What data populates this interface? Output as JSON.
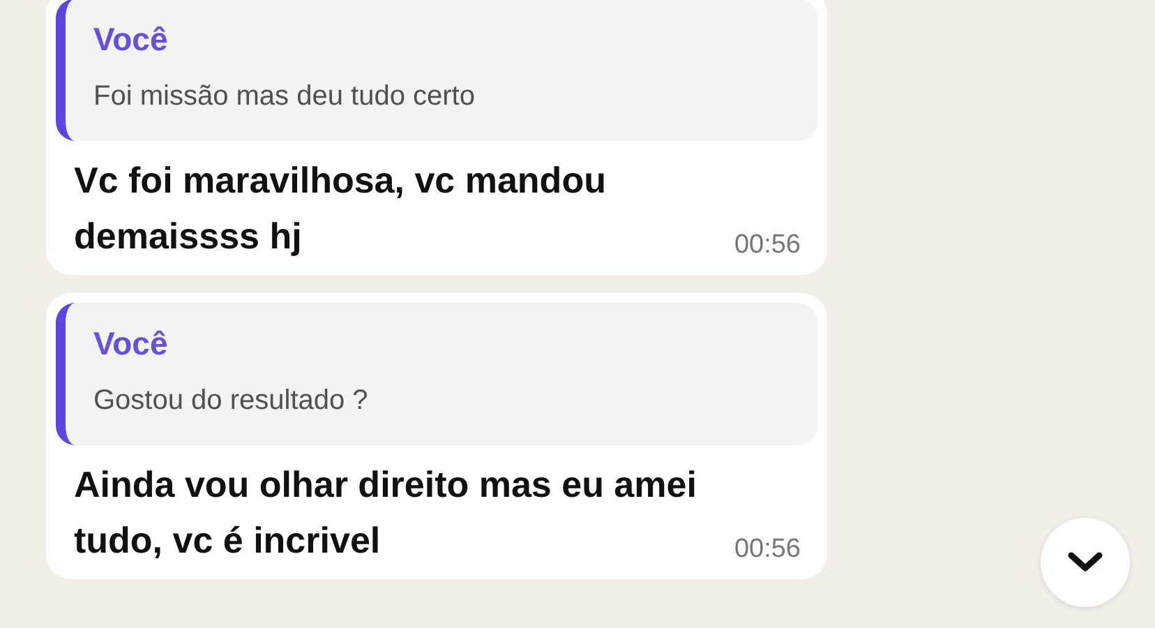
{
  "messages": [
    {
      "quote": {
        "author": "Você",
        "text": "Foi missão mas deu tudo certo"
      },
      "text": "Vc foi maravilhosa, vc mandou demaissss hj",
      "time": "00:56"
    },
    {
      "quote": {
        "author": "Você",
        "text": "Gostou do resultado ?"
      },
      "text": "Ainda vou olhar direito mas eu amei tudo, vc é incrivel",
      "time": "00:56"
    }
  ]
}
